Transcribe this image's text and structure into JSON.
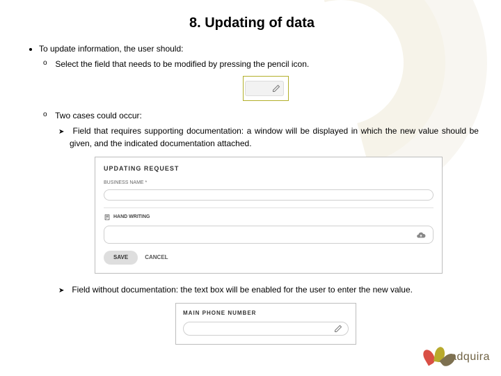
{
  "title": "8. Updating of data",
  "intro": "To update information, the user should:",
  "sub1": "Select the field that needs to be modified by pressing the pencil icon.",
  "sub2": "Two cases could occur:",
  "case1": "Field that requires supporting documentation: a window will be displayed in which the new value should be given, and the indicated documentation attached.",
  "case2": "Field without documentation: the text box will be enabled for the user to enter the new value.",
  "dialog": {
    "title": "UPDATING REQUEST",
    "field_label": "BUSINESS NAME *",
    "section_label": "HAND WRITING",
    "save": "SAVE",
    "cancel": "CANCEL"
  },
  "phone_label": "MAIN PHONE NUMBER",
  "logo_text": "adquira"
}
